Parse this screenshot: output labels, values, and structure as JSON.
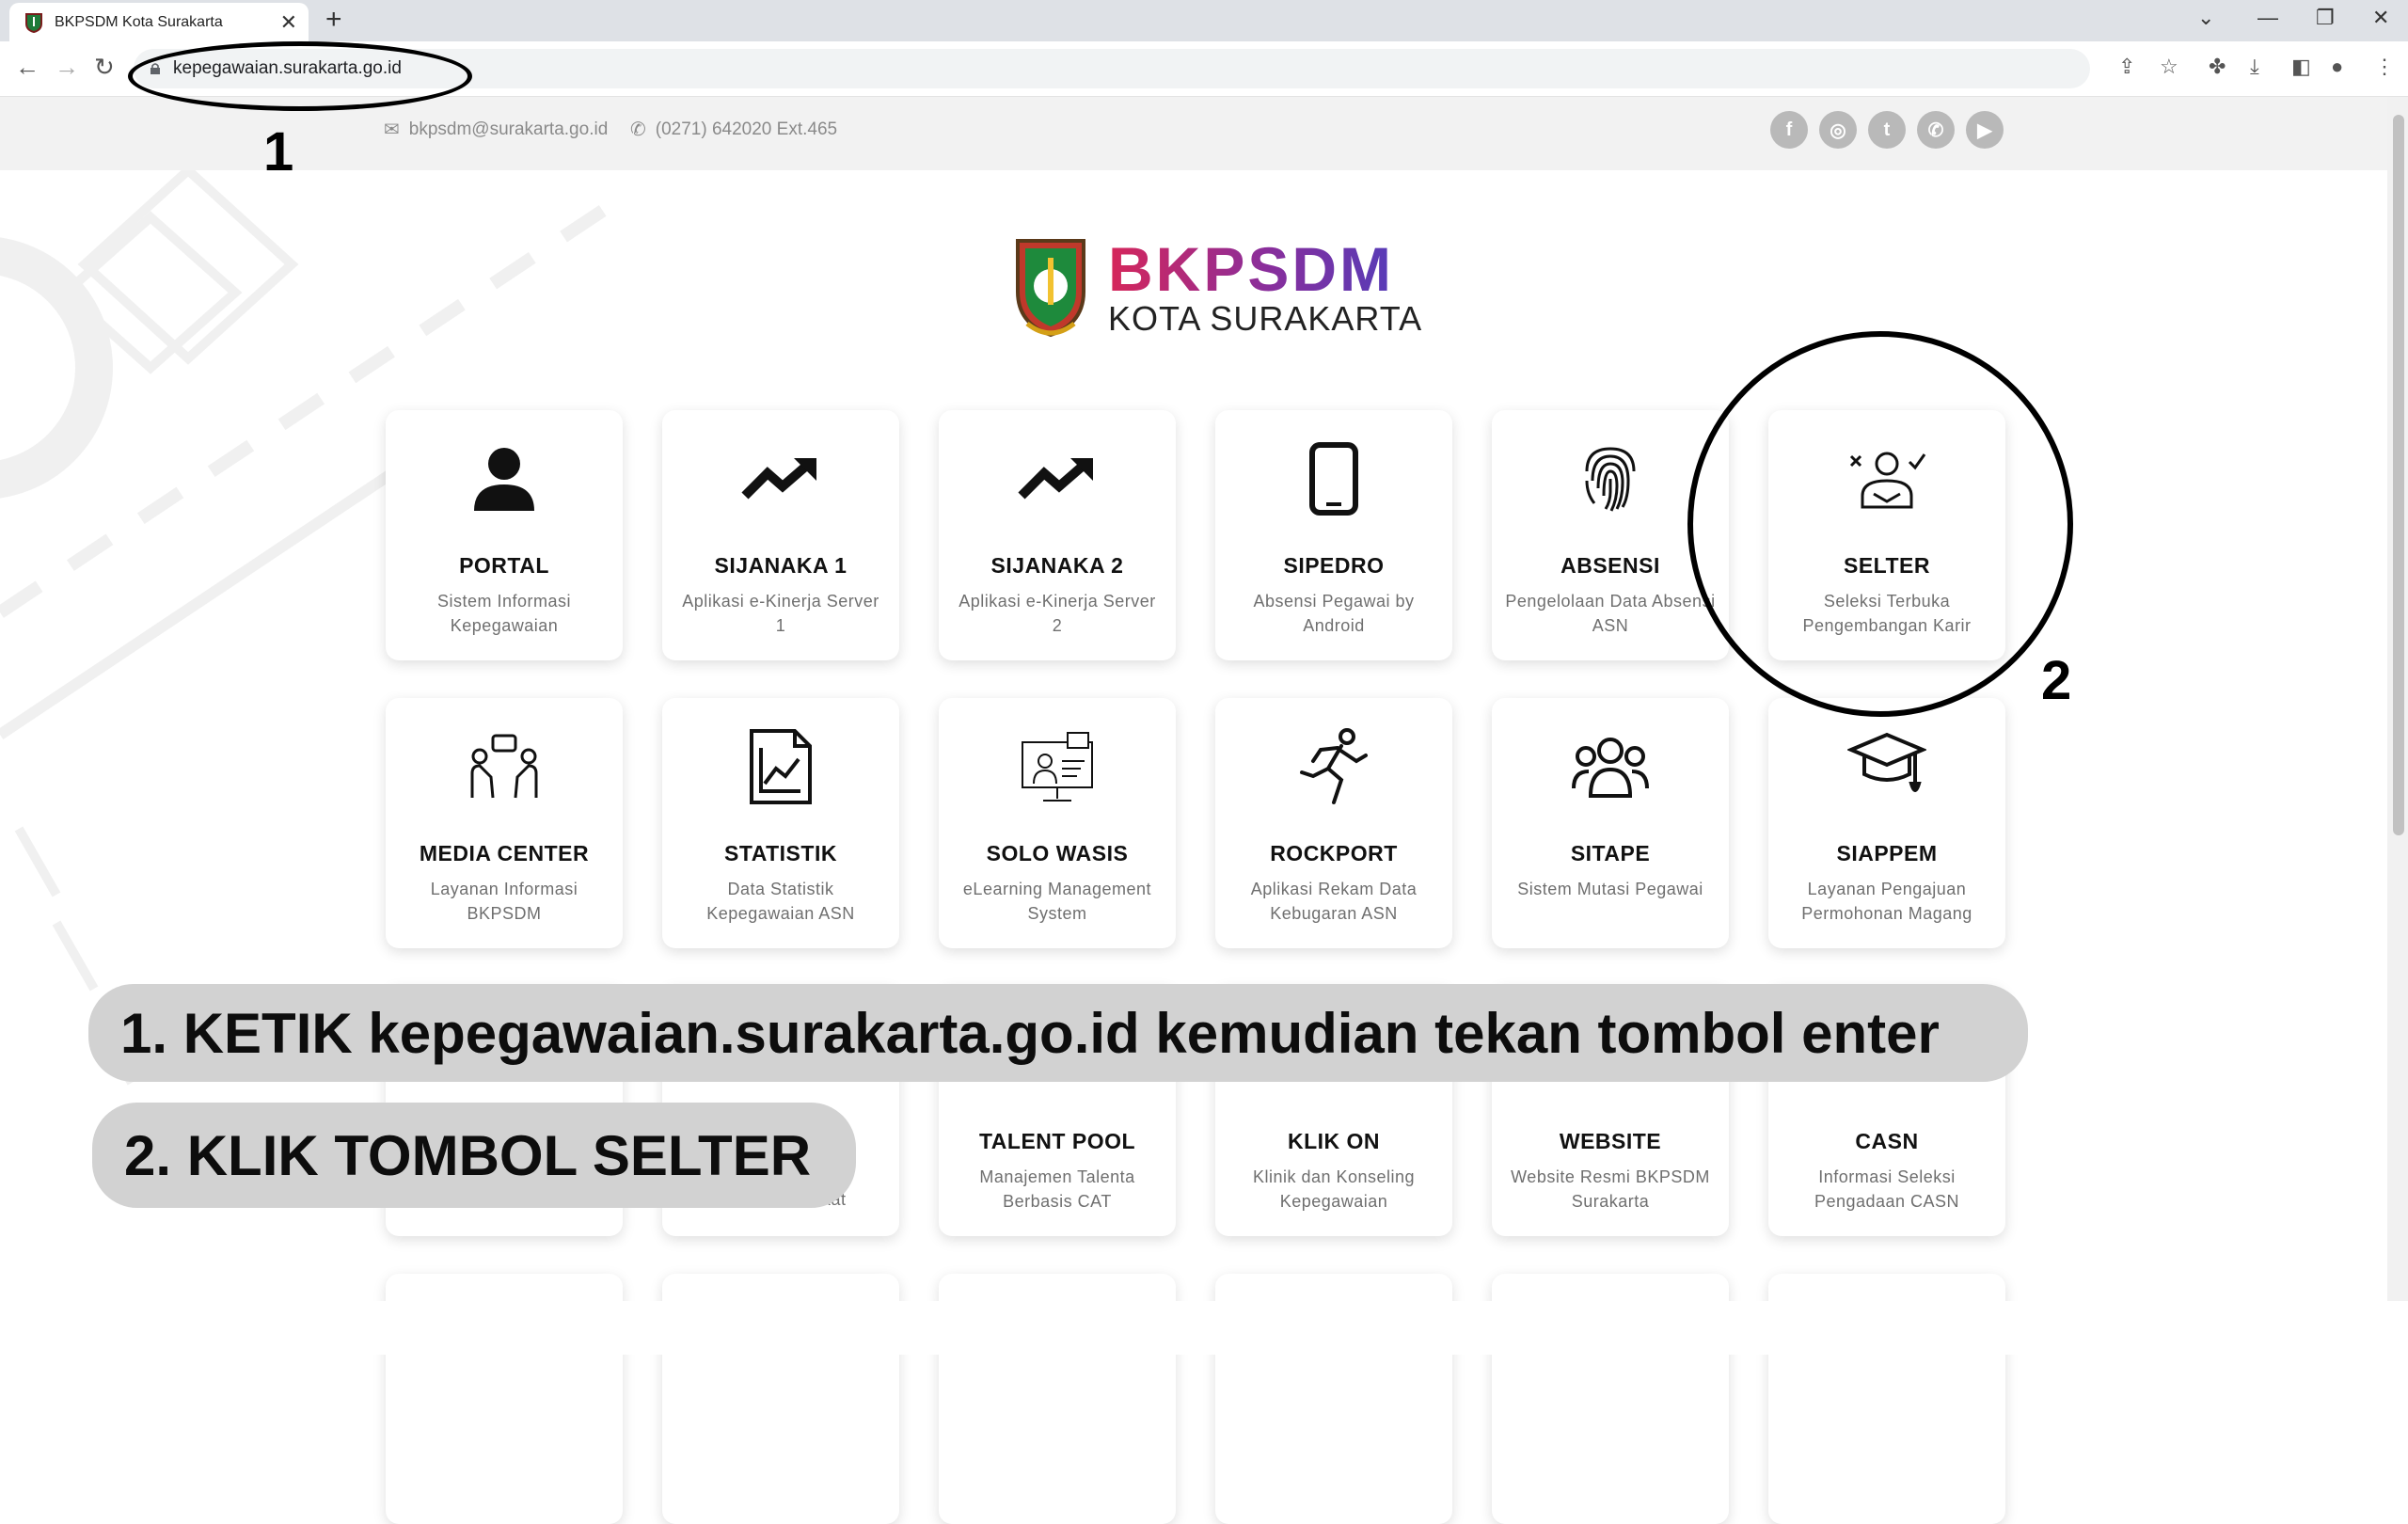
{
  "browser": {
    "tab_title": "BKPSDM Kota Surakarta",
    "tab_close": "✕",
    "new_tab": "+",
    "url": "kepegawaian.surakarta.go.id"
  },
  "topbar": {
    "email": "bkpsdm@surakarta.go.id",
    "phone": "(0271) 642020 Ext.465",
    "social": [
      "facebook-icon",
      "instagram-icon",
      "twitter-icon",
      "whatsapp-icon",
      "youtube-icon"
    ]
  },
  "logo": {
    "brand": "BKPSDM",
    "sub": "KOTA SURAKARTA"
  },
  "cards": [
    {
      "name": "PORTAL",
      "desc": "Sistem Informasi Kepegawaian",
      "icon": "user-icon"
    },
    {
      "name": "SIJANAKA 1",
      "desc": "Aplikasi e-Kinerja Server 1",
      "icon": "trending-up-icon"
    },
    {
      "name": "SIJANAKA 2",
      "desc": "Aplikasi e-Kinerja Server 2",
      "icon": "trending-up-icon"
    },
    {
      "name": "SIPEDRO",
      "desc": "Absensi Pegawai by Android",
      "icon": "smartphone-icon"
    },
    {
      "name": "ABSENSI",
      "desc": "Pengelolaan Data Absensi ASN",
      "icon": "fingerprint-icon"
    },
    {
      "name": "SELTER",
      "desc": "Seleksi Terbuka Pengembangan Karir",
      "icon": "candidate-select-icon"
    },
    {
      "name": "MEDIA CENTER",
      "desc": "Layanan Informasi BKPSDM",
      "icon": "discussion-icon"
    },
    {
      "name": "STATISTIK",
      "desc": "Data Statistik Kepegawaian ASN",
      "icon": "chart-document-icon"
    },
    {
      "name": "SOLO WASIS",
      "desc": "eLearning Management System",
      "icon": "elearning-icon"
    },
    {
      "name": "ROCKPORT",
      "desc": "Aplikasi Rekam Data Kebugaran ASN",
      "icon": "running-icon"
    },
    {
      "name": "SITAPE",
      "desc": "Sistem Mutasi Pegawai",
      "icon": "group-icon"
    },
    {
      "name": "SIAPPEM",
      "desc": "Layanan Pengajuan Permohonan Magang",
      "icon": "graduation-cap-icon"
    },
    {
      "name": "TALENT POOL",
      "desc": "Manajemen Talenta Berbasis CAT",
      "icon": ""
    },
    {
      "name": "KLIK ON",
      "desc": "Klinik dan Konseling Kepegawaian",
      "icon": ""
    },
    {
      "name": "WEBSITE",
      "desc": "Website Resmi BKPSDM Surakarta",
      "icon": ""
    },
    {
      "name": "CASN",
      "desc": "Informasi Seleksi Pengadaan CASN",
      "icon": ""
    }
  ],
  "partial_card_text": "kat",
  "annotations": {
    "mark1": "1",
    "mark2": "2",
    "step1": "1. KETIK kepegawaian.surakarta.go.id kemudian tekan tombol enter",
    "step2": "2. KLIK TOMBOL SELTER"
  },
  "colors": {
    "brand_start": "#d6265a",
    "brand_end": "#4b3fbe",
    "banner": "#d2d2d2"
  }
}
